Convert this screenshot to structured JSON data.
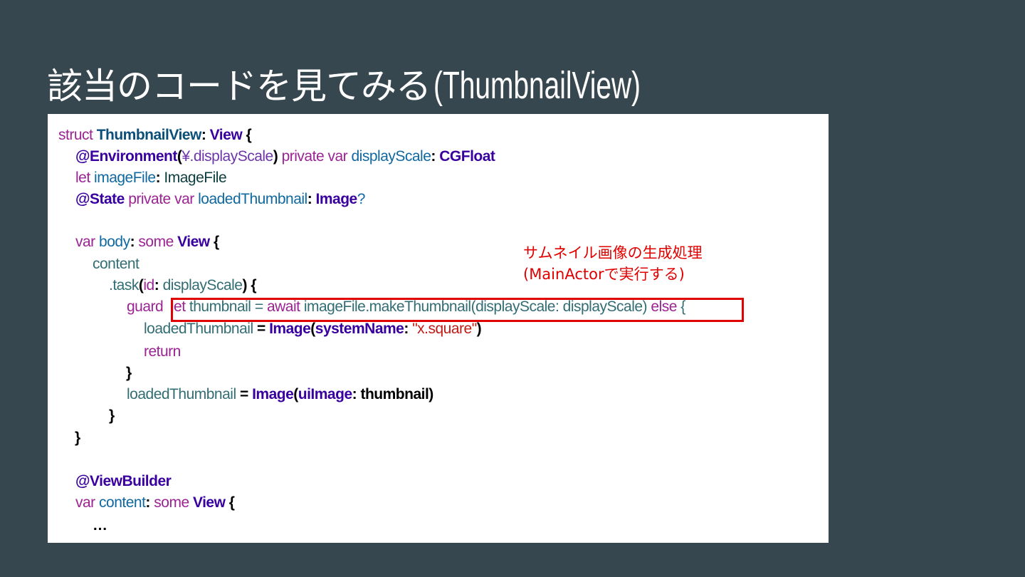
{
  "title": {
    "japanese": "該当のコードを見てみる",
    "english": "(ThumbnailView)"
  },
  "annotation": {
    "line1": "サムネイル画像の生成処理",
    "line2": "(MainActorで実行する)"
  },
  "code": {
    "l1": {
      "a": "struct",
      "b": "ThumbnailView",
      "c": ":",
      "d": "View",
      "e": "{"
    },
    "l2": {
      "a": "@Environment",
      "b": "(",
      "c": "¥.displayScale",
      "d": ")",
      "e": "private",
      "f": "var",
      "g": "displayScale",
      "h": ":",
      "i": "CGFloat"
    },
    "l3": {
      "a": "let",
      "b": "imageFile",
      "c": ":",
      "d": "ImageFile"
    },
    "l4": {
      "a": "@State",
      "b": "private",
      "c": "var",
      "d": "loadedThumbnail",
      "e": ":",
      "f": "Image",
      "g": "?"
    },
    "l5": {
      "a": "var",
      "b": "body",
      "c": ":",
      "d": "some",
      "e": "View",
      "f": "{"
    },
    "l6": {
      "a": "content"
    },
    "l7": {
      "a": ".task",
      "b": "(",
      "c": "id",
      "d": ":",
      "e": "displayScale",
      "f": ")",
      "g": "{"
    },
    "l8": {
      "a": "guard",
      "b": "let",
      "c": "thumbnail",
      "d": "=",
      "e": "await",
      "f": "imageFile.makeThumbnail(displayScale: displayScale)",
      "g": "else",
      "h": "{"
    },
    "l9": {
      "a": "loadedThumbnail",
      "b": "=",
      "c": "Image",
      "d": "(",
      "e": "systemName",
      "f": ":",
      "g": "\"x.square\"",
      "h": ")"
    },
    "l10": {
      "a": "return"
    },
    "l11": {
      "a": "}"
    },
    "l12": {
      "a": "loadedThumbnail",
      "b": "=",
      "c": "Image",
      "d": "(",
      "e": "uiImage",
      "f": ":",
      "g": "thumbnail",
      "h": ")"
    },
    "l13": {
      "a": "}"
    },
    "l14": {
      "a": "}"
    },
    "l15": {
      "a": "@ViewBuilder"
    },
    "l16": {
      "a": "var",
      "b": "content",
      "c": ":",
      "d": "some",
      "e": "View",
      "f": "{"
    },
    "l17": {
      "a": "…"
    }
  },
  "colors": {
    "background": "#37474f",
    "code_background": "#ffffff",
    "highlight": "#e00000",
    "keyword": "#9b2393",
    "type": "#3900a0",
    "identifier": "#0f68a0",
    "property": "#326d74",
    "string": "#c41a16"
  }
}
